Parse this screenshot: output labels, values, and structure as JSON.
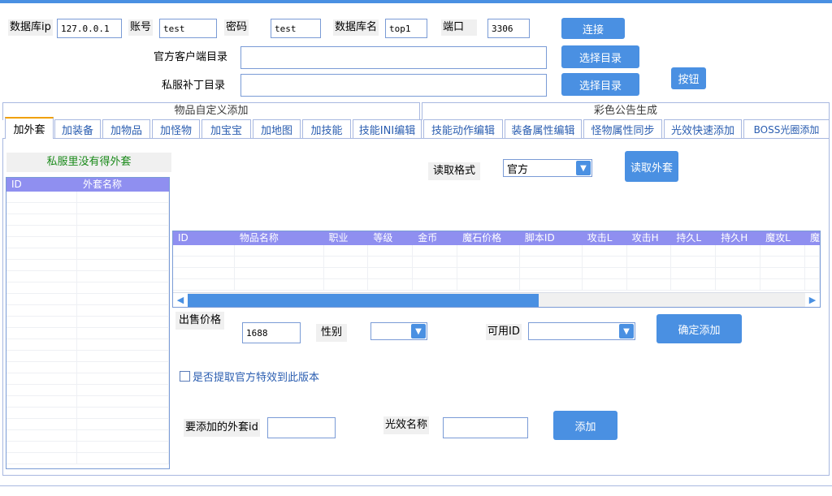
{
  "connection": {
    "db_ip_label": "数据库ip",
    "db_ip_value": "127.0.0.1",
    "account_label": "账号",
    "account_value": "test",
    "password_label": "密码",
    "password_value": "test",
    "db_name_label": "数据库名",
    "db_name_value": "top1",
    "port_label": "端口",
    "port_value": "3306",
    "connect_button": "连接"
  },
  "directories": {
    "official_client_label": "官方客户端目录",
    "official_client_value": "",
    "private_patch_label": "私服补丁目录",
    "private_patch_value": "",
    "select_dir_button_1": "选择目录",
    "select_dir_button_2": "选择目录",
    "generic_button": "按钮"
  },
  "group_headers": {
    "left": "物品自定义添加",
    "right": "彩色公告生成"
  },
  "tabs": [
    {
      "label": "加外套",
      "active": true
    },
    {
      "label": "加装备"
    },
    {
      "label": "加物品"
    },
    {
      "label": "加怪物"
    },
    {
      "label": "加宝宝"
    },
    {
      "label": "加地图"
    },
    {
      "label": "加技能"
    },
    {
      "label": "技能INI编辑"
    },
    {
      "label": "技能动作编辑"
    },
    {
      "label": "装备属性编辑"
    },
    {
      "label": "怪物属性同步"
    },
    {
      "label": "光效快速添加"
    },
    {
      "label": "BOSS光圈添加"
    }
  ],
  "left_panel": {
    "title": "私服里没有得外套",
    "columns": [
      "ID",
      "外套名称"
    ]
  },
  "read": {
    "format_label": "读取格式",
    "format_value": "官方",
    "read_button": "读取外套"
  },
  "items_grid": {
    "columns": [
      "ID",
      "物品名称",
      "职业",
      "等级",
      "金币",
      "魔石价格",
      "脚本ID",
      "攻击L",
      "攻击H",
      "持久L",
      "持久H",
      "魔攻L",
      "魔"
    ]
  },
  "sale": {
    "price_label": "出售价格",
    "price_value": "1688",
    "gender_label": "性别",
    "gender_value": "",
    "available_id_label": "可用ID",
    "available_id_value": "",
    "confirm_button": "确定添加"
  },
  "effects": {
    "extract_checkbox_label": "是否提取官方特效到此版本",
    "coat_id_label": "要添加的外套id",
    "coat_id_value": "",
    "effect_name_label": "光效名称",
    "effect_name_value": "",
    "add_button": "添加"
  },
  "colors": {
    "accent": "#4a90e2",
    "header": "#8f8ff0",
    "title_green": "#1a8a1a"
  }
}
